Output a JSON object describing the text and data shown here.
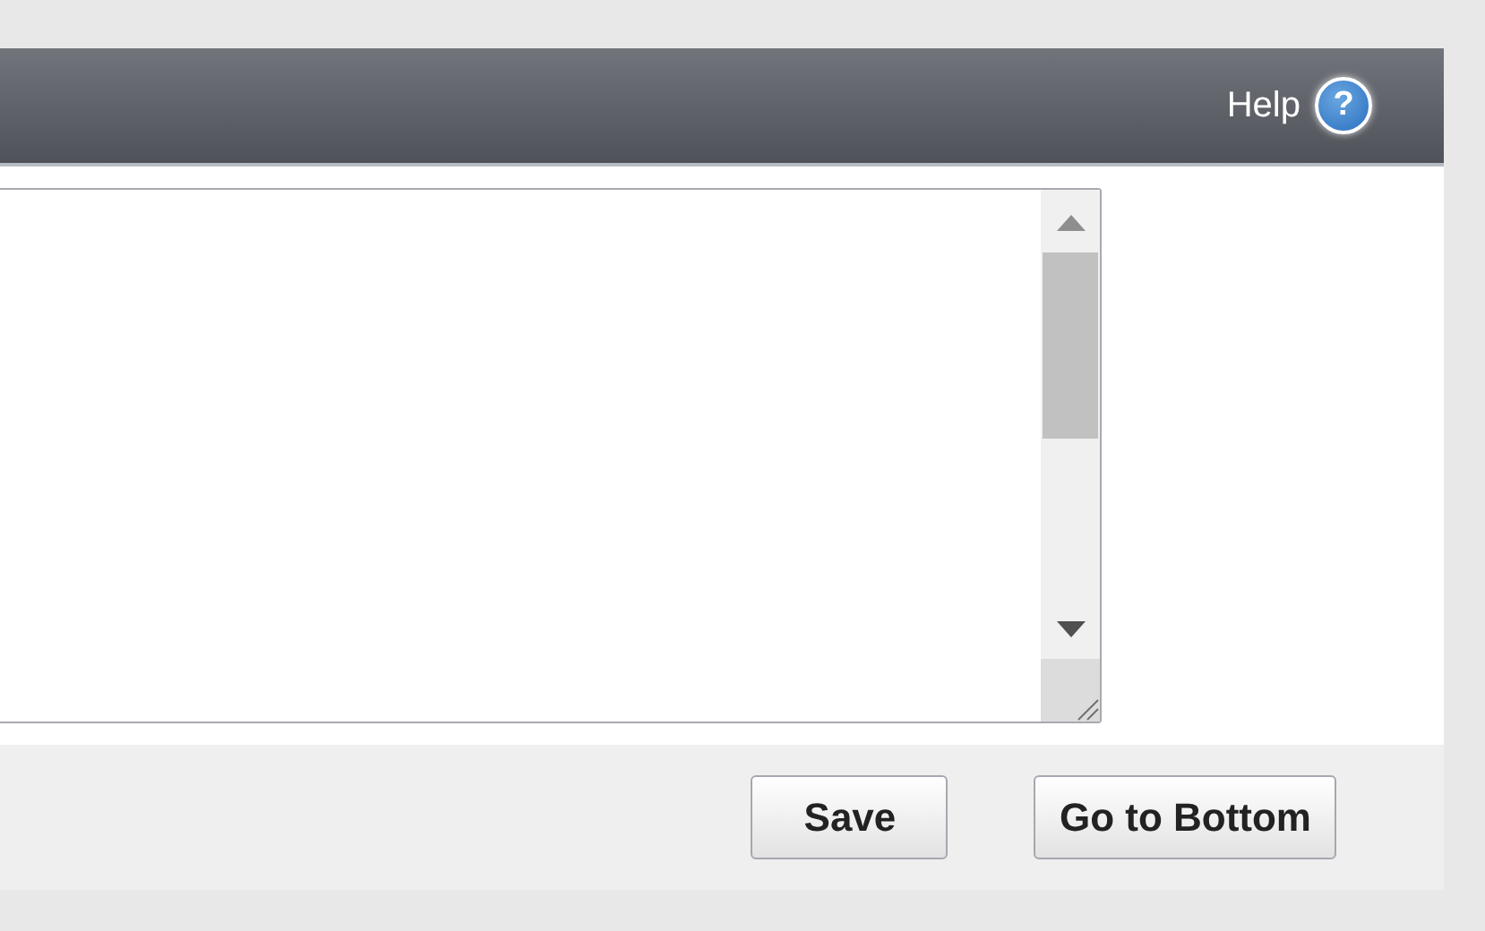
{
  "header": {
    "help_label": "Help",
    "help_icon": "?"
  },
  "editor": {
    "kind": "textarea"
  },
  "buttons": [
    "Save",
    "Go to Bottom"
  ]
}
